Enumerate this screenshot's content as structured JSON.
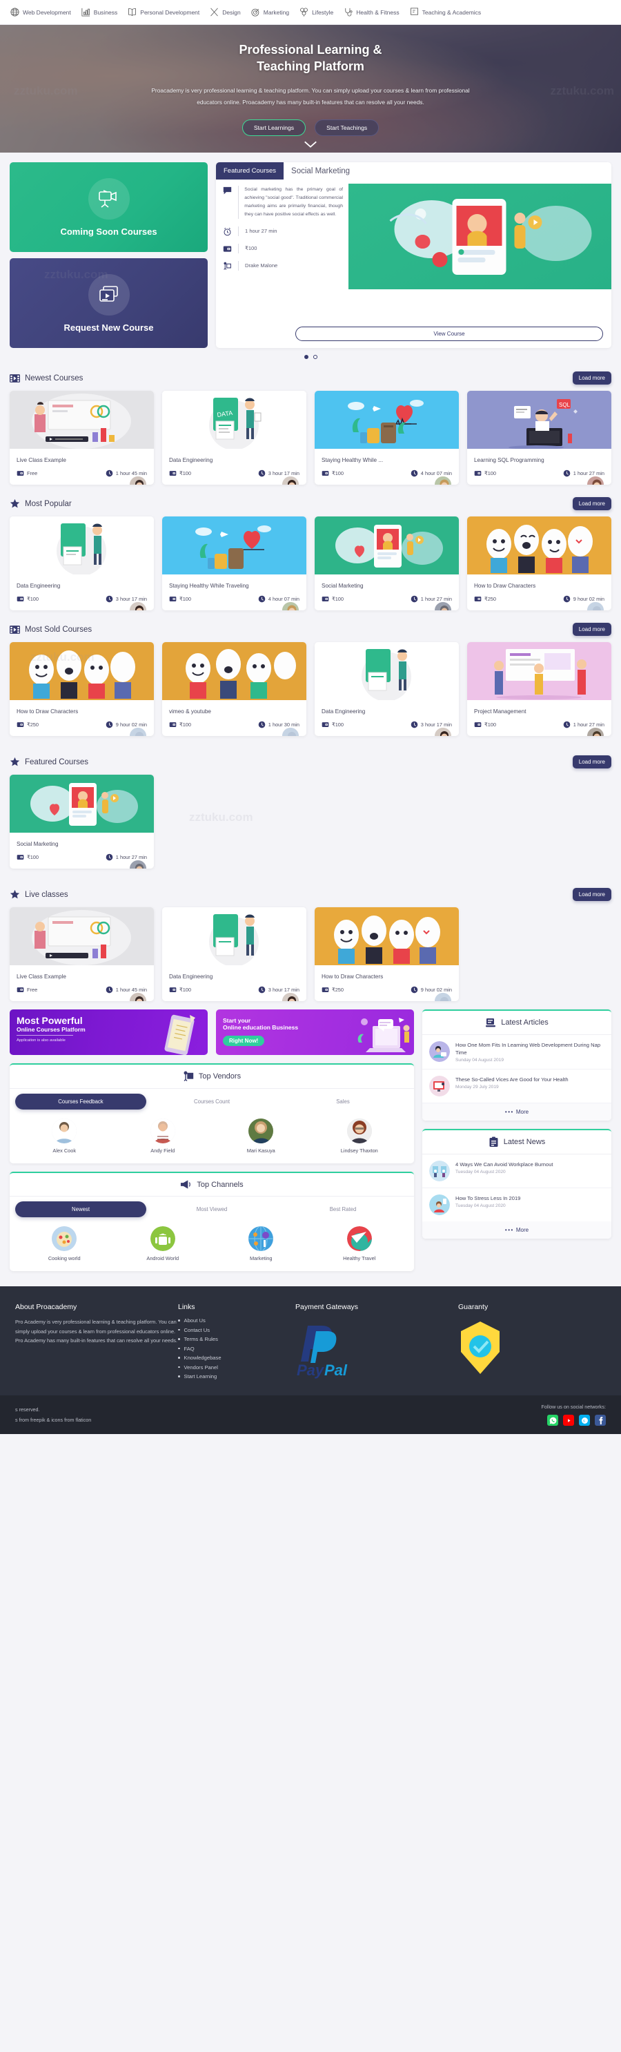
{
  "topnav": {
    "items": [
      {
        "label": "Web Development",
        "icon": "globe-icon"
      },
      {
        "label": "Business",
        "icon": "chart-bar-icon"
      },
      {
        "label": "Personal Development",
        "icon": "open-book-icon"
      },
      {
        "label": "Design",
        "icon": "pencil-ruler-icon"
      },
      {
        "label": "Marketing",
        "icon": "target-icon"
      },
      {
        "label": "Lifestyle",
        "icon": "balloons-icon"
      },
      {
        "label": "Health & Fitness",
        "icon": "stethoscope-icon"
      },
      {
        "label": "Teaching & Academics",
        "icon": "presentation-icon"
      }
    ]
  },
  "hero": {
    "title_line1": "Professional Learning &",
    "title_line2": "Teaching Platform",
    "subtitle": "Proacademy is very professional learning & teaching platform. You can simply upload your courses & learn from professional educators online. Proacademy has many built-in features that can resolve all your needs.",
    "btn_primary": "Start Learnings",
    "btn_secondary": "Start Teachings",
    "scroll_icon": "chevron-down-icon"
  },
  "promos": {
    "coming_soon": {
      "label": "Coming Soon Courses",
      "icon": "video-camera-icon"
    },
    "request_new": {
      "label": "Request New Course",
      "icon": "video-player-icon"
    }
  },
  "featured_hero": {
    "tab_label": "Featured Courses",
    "course_title": "Social Marketing",
    "description": "Social marketing has the primary goal of achieving \"social good\". Traditional commercial marketing aims are primarily financial, though they can have positive social effects as well.",
    "duration": "1 hour 27 min",
    "price": "₹100",
    "author": "Drake Malone",
    "view_button": "View Course",
    "slides": 2,
    "active_slide": 1
  },
  "sections": {
    "newest": {
      "title": "Newest Courses",
      "icon": "film-icon",
      "load_more": "Load more",
      "courses": [
        {
          "name": "Live Class Example",
          "price": "Free",
          "duration": "1 hour 45 min",
          "thumb": "#e3e3e6"
        },
        {
          "name": "Data Engineering",
          "price": "₹100",
          "duration": "3 hour 17 min",
          "thumb": "#ffffff"
        },
        {
          "name": "Staying Healthy While ...",
          "price": "₹100",
          "duration": "4 hour 07 min",
          "thumb": "#4ec3f0"
        },
        {
          "name": "Learning SQL Programming",
          "price": "₹100",
          "duration": "1 hour 27 min",
          "thumb": "#8f96cd"
        }
      ]
    },
    "popular": {
      "title": "Most Popular",
      "icon": "star-icon",
      "load_more": "Load more",
      "courses": [
        {
          "name": "Data Engineering",
          "price": "₹100",
          "duration": "3 hour 17 min",
          "thumb": "#ffffff"
        },
        {
          "name": "Staying Healthy While Traveling",
          "price": "₹100",
          "duration": "4 hour 07 min",
          "thumb": "#4ec3f0"
        },
        {
          "name": "Social Marketing",
          "price": "₹100",
          "duration": "1 hour 27 min",
          "thumb": "#2eb489"
        },
        {
          "name": "How to Draw Characters",
          "price": "₹250",
          "duration": "9 hour 02 min",
          "thumb": "#e8a93c"
        }
      ]
    },
    "most_sold": {
      "title": "Most Sold Courses",
      "icon": "film-icon",
      "load_more": "Load more",
      "courses": [
        {
          "name": "How to Draw Characters",
          "price": "₹250",
          "duration": "9 hour 02 min",
          "thumb": "#e3a43a"
        },
        {
          "name": "vimeo & youtube",
          "price": "₹100",
          "duration": "1 hour 30 min",
          "thumb": "#e3a43a"
        },
        {
          "name": "Data Engineering",
          "price": "₹100",
          "duration": "3 hour 17 min",
          "thumb": "#ffffff"
        },
        {
          "name": "Project Management",
          "price": "₹100",
          "duration": "1 hour 27 min",
          "thumb": "#eec3e8"
        }
      ]
    },
    "featured": {
      "title": "Featured Courses",
      "icon": "star-icon",
      "load_more": "Load more",
      "courses": [
        {
          "name": "Social Marketing",
          "price": "₹100",
          "duration": "1 hour 27 min",
          "thumb": "#2eb489"
        }
      ]
    },
    "live": {
      "title": "Live classes",
      "icon": "star-icon",
      "load_more": "Load more",
      "courses": [
        {
          "name": "Live Class Example",
          "price": "Free",
          "duration": "1 hour 45 min",
          "thumb": "#e3e3e6"
        },
        {
          "name": "Data Engineering",
          "price": "₹100",
          "duration": "3 hour 17 min",
          "thumb": "#ffffff"
        },
        {
          "name": "How to Draw Characters",
          "price": "₹250",
          "duration": "9 hour 02 min",
          "thumb": "#e8a93c"
        }
      ]
    }
  },
  "banners": {
    "left": {
      "title": "Most Powerful",
      "subtitle": "Online Courses Platform",
      "note": "Application is also available"
    },
    "right": {
      "line1": "Start your",
      "line2": "Online education Business",
      "pill": "Right Now!"
    }
  },
  "top_vendors": {
    "title": "Top Vendors",
    "icon": "presentation-icon",
    "tabs": [
      "Courses Feedback",
      "Courses Count",
      "Sales"
    ],
    "active_tab": 0,
    "people": [
      {
        "name": "Alex Cook",
        "color": "#9fc0dd"
      },
      {
        "name": "Andy Field",
        "color": "#c75a52"
      },
      {
        "name": "Mari Kasuya",
        "color": "#5f7a42"
      },
      {
        "name": "Lindsey Thaxton",
        "color": "#a4543d"
      }
    ]
  },
  "top_channels": {
    "title": "Top Channels",
    "icon": "megaphone-icon",
    "tabs": [
      "Newest",
      "Most Viewed",
      "Best Rated"
    ],
    "active_tab": 0,
    "channels": [
      {
        "name": "Cooking world",
        "color": "#bcd7ee"
      },
      {
        "name": "Android World",
        "color": "#8cc63f"
      },
      {
        "name": "Marketing",
        "color": "#3fa0dd"
      },
      {
        "name": "Healthy Travel",
        "color": "#2fb5a0"
      }
    ]
  },
  "latest_articles": {
    "title": "Latest Articles",
    "icon": "article-icon",
    "more_label": "More",
    "items": [
      {
        "title": "How One Mom Fits In Learning Web Development During Nap Time",
        "date": "Sunday 04 August 2019",
        "color": "#b9b5e8"
      },
      {
        "title": "These So-Called Vices Are Good for Your Health",
        "date": "Monday 29 July 2019",
        "color": "#f2dce8"
      }
    ]
  },
  "latest_news": {
    "title": "Latest News",
    "icon": "clipboard-icon",
    "more_label": "More",
    "items": [
      {
        "title": "4 Ways We Can Avoid Workplace Burnout",
        "date": "Tuesday 04 August 2020",
        "color": "#cfe7f5"
      },
      {
        "title": "How To Stress Less In 2019",
        "date": "Tuesday 04 August 2020",
        "color": "#a8dcf0"
      }
    ]
  },
  "footer": {
    "about": {
      "heading": "About Proacademy",
      "text": "Pro Academy is very professional learning & teaching platform. You can simply upload your courses & learn from professional educators online. Pro Academy has many built-in features that can resolve all your needs."
    },
    "links": {
      "heading": "Links",
      "items": [
        "About Us",
        "Contact Us",
        "Terms & Rules",
        "FAQ",
        "Knowledgebase",
        "Vendors Panel",
        "Start Learning"
      ]
    },
    "payments": {
      "heading": "Payment Gateways",
      "logo": "paypal-logo"
    },
    "guaranty": {
      "heading": "Guaranty",
      "icon": "shield-check-icon"
    },
    "bar": {
      "copyright": "s reserved.",
      "credits": "s from freepik & icons from flaticon",
      "follow": "Follow us on social networks:",
      "socials": [
        "whatsapp-icon",
        "youtube-icon",
        "skype-icon",
        "facebook-icon"
      ]
    }
  },
  "watermarks": [
    "zztuku.com",
    "zztuku.com",
    "zztuku.com",
    "zztuku.com",
    "zztuku.com"
  ]
}
